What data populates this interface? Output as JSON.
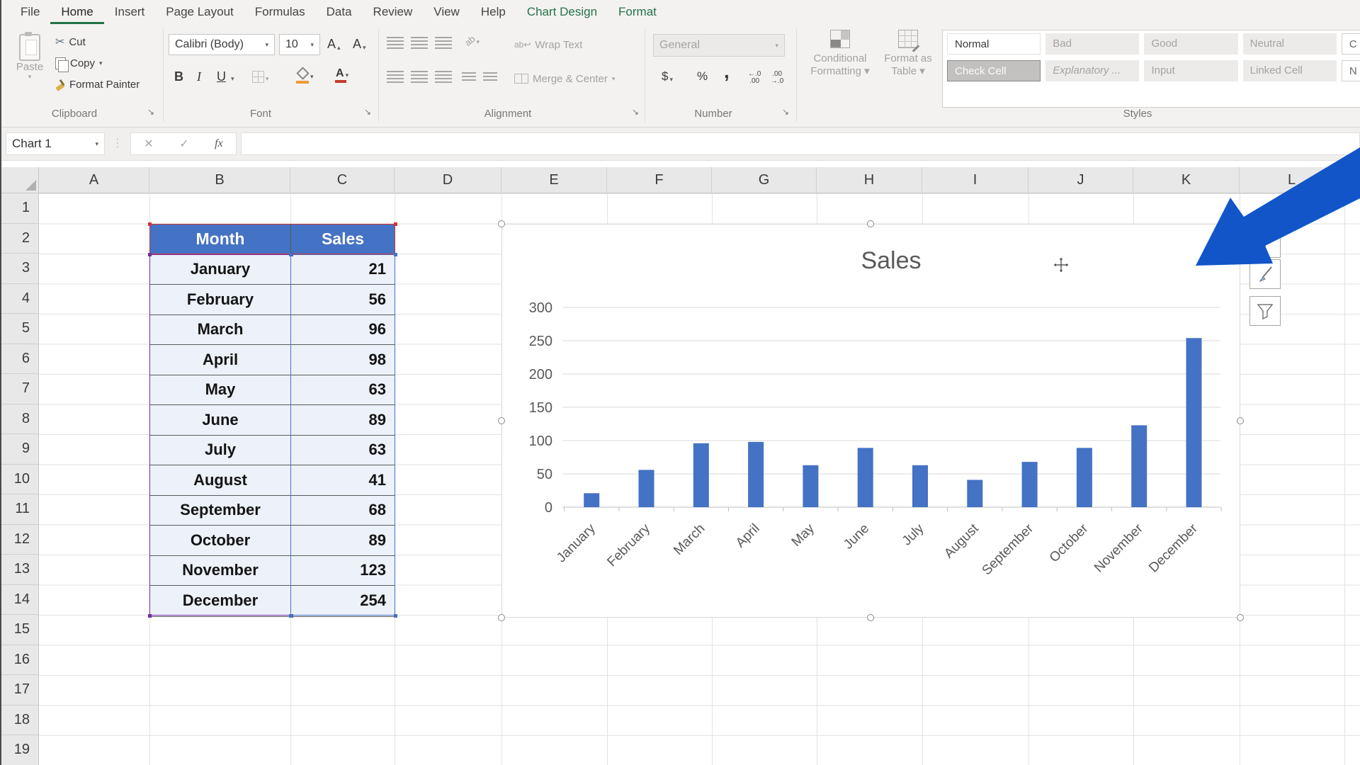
{
  "tabs": {
    "items": [
      {
        "label": "File",
        "state": "normal"
      },
      {
        "label": "Home",
        "state": "active"
      },
      {
        "label": "Insert",
        "state": "normal"
      },
      {
        "label": "Page Layout",
        "state": "normal"
      },
      {
        "label": "Formulas",
        "state": "normal"
      },
      {
        "label": "Data",
        "state": "normal"
      },
      {
        "label": "Review",
        "state": "normal"
      },
      {
        "label": "View",
        "state": "normal"
      },
      {
        "label": "Help",
        "state": "normal"
      },
      {
        "label": "Chart Design",
        "state": "contextual"
      },
      {
        "label": "Format",
        "state": "contextual"
      }
    ]
  },
  "glyphs": {
    "dropdown": "▾",
    "launcher": "↘",
    "ellipsis": "⋮",
    "scissors": "✂",
    "plus": "+",
    "cancel": "✕",
    "enter": "✓",
    "fx": "fx",
    "caret_up": "▴",
    "caret_down": "▾"
  },
  "ribbon": {
    "clipboard": {
      "group_label": "Clipboard",
      "paste": "Paste",
      "cut": "Cut",
      "copy": "Copy",
      "format_painter": "Format Painter"
    },
    "font": {
      "group_label": "Font",
      "font_name": "Calibri (Body)",
      "font_size": "10",
      "bold": "B",
      "italic": "I",
      "underline": "U",
      "grow_font": "A",
      "shrink_font": "A"
    },
    "alignment": {
      "group_label": "Alignment",
      "orientation": "ab",
      "wrap_text": "Wrap Text",
      "merge_center": "Merge & Center"
    },
    "number": {
      "group_label": "Number",
      "format": "General",
      "currency": "$",
      "percent": "%",
      "comma": ",",
      "decimal_icons": [
        {
          "top": "←.0",
          "bottom": ".00"
        },
        {
          "top": ".00",
          "bottom": "→.0"
        }
      ]
    },
    "styles": {
      "group_label": "Styles",
      "conditional_formatting_1": "Conditional",
      "conditional_formatting_2": "Formatting ▾",
      "format_as_table_1": "Format as",
      "format_as_table_2": "Table ▾",
      "gallery_row1": [
        {
          "label": "Normal",
          "state": "normal-white"
        },
        {
          "label": "Bad",
          "state": "disabled"
        },
        {
          "label": "Good",
          "state": "disabled"
        },
        {
          "label": "Neutral",
          "state": "disabled"
        },
        {
          "label": "C",
          "state": "partial"
        }
      ],
      "gallery_row2": [
        {
          "label": "Check Cell",
          "state": "selected"
        },
        {
          "label": "Explanatory ...",
          "state": "disabled-italic"
        },
        {
          "label": "Input",
          "state": "disabled"
        },
        {
          "label": "Linked Cell",
          "state": "disabled"
        },
        {
          "label": "N",
          "state": "partial"
        }
      ]
    }
  },
  "formula_bar": {
    "name_box": "Chart 1"
  },
  "sheet": {
    "columns": [
      "A",
      "B",
      "C",
      "D",
      "E",
      "F",
      "G",
      "H",
      "I",
      "J",
      "K",
      "L"
    ],
    "rows": [
      "1",
      "2",
      "3",
      "4",
      "5",
      "6",
      "7",
      "8",
      "9",
      "10",
      "11",
      "12",
      "13",
      "14",
      "15",
      "16",
      "17",
      "18",
      "19"
    ]
  },
  "table": {
    "headers": [
      "Month",
      "Sales"
    ],
    "rows": [
      [
        "January",
        "21"
      ],
      [
        "February",
        "56"
      ],
      [
        "March",
        "96"
      ],
      [
        "April",
        "98"
      ],
      [
        "May",
        "63"
      ],
      [
        "June",
        "89"
      ],
      [
        "July",
        "63"
      ],
      [
        "August",
        "41"
      ],
      [
        "September",
        "68"
      ],
      [
        "October",
        "89"
      ],
      [
        "November",
        "123"
      ],
      [
        "December",
        "254"
      ]
    ]
  },
  "chart_data": {
    "type": "bar",
    "title": "Sales",
    "categories": [
      "January",
      "February",
      "March",
      "April",
      "May",
      "June",
      "July",
      "August",
      "September",
      "October",
      "November",
      "December"
    ],
    "values": [
      21,
      56,
      96,
      98,
      63,
      89,
      63,
      41,
      68,
      89,
      123,
      254
    ],
    "xlabel": "",
    "ylabel": "",
    "ylim": [
      0,
      300
    ],
    "ytick_step": 50,
    "bar_color": "#4472c4",
    "grid": true,
    "legend": false,
    "text_color": "#595959",
    "gridline_color": "#d9d9d9"
  },
  "colors": {
    "accent_green": "#217346",
    "table_header_blue": "#4472c4",
    "range_values_blue": "#4472c4",
    "range_categories_purple": "#7030a0",
    "range_header_red": "#d13438"
  },
  "annotation": {
    "arrow_color": "#1155c8"
  }
}
